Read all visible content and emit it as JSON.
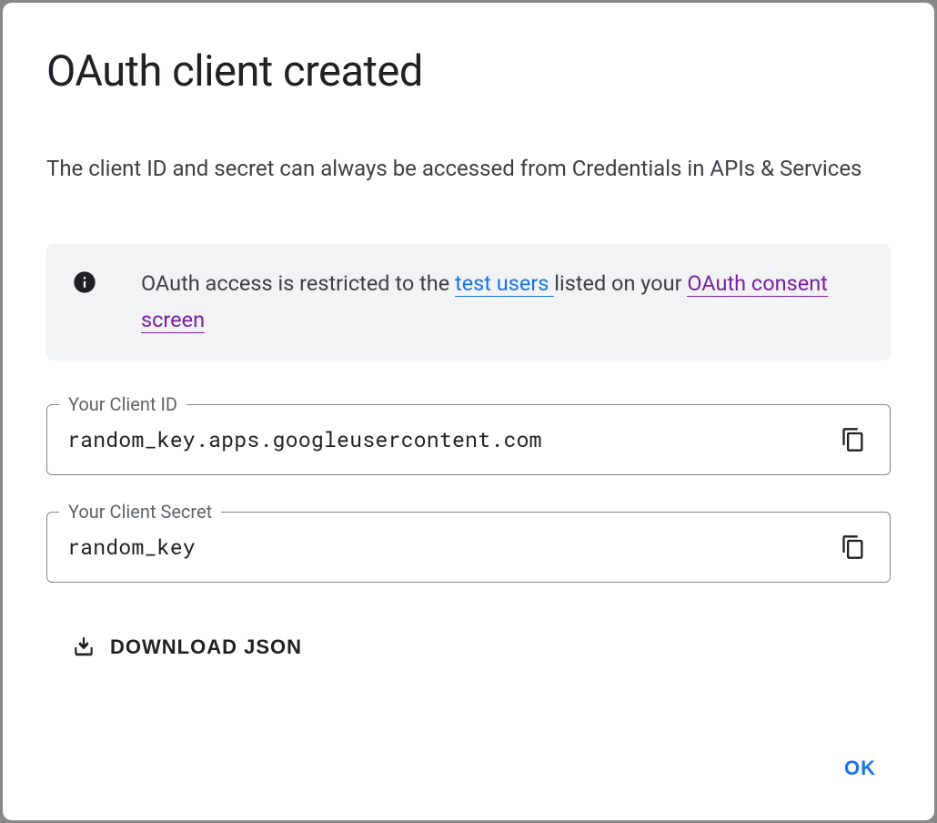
{
  "dialog": {
    "title": "OAuth client created",
    "description": "The client ID and secret can always be accessed from Credentials in APIs & Services"
  },
  "info": {
    "text_prefix": "OAuth access is restricted to the ",
    "link1": "test users ",
    "text_mid": "listed on your ",
    "link2": "OAuth consent screen"
  },
  "fields": {
    "client_id": {
      "label": "Your Client ID",
      "value": "random_key.apps.googleusercontent.com"
    },
    "client_secret": {
      "label": "Your Client Secret",
      "value": "random_key"
    }
  },
  "actions": {
    "download": "DOWNLOAD JSON",
    "ok": "OK"
  }
}
